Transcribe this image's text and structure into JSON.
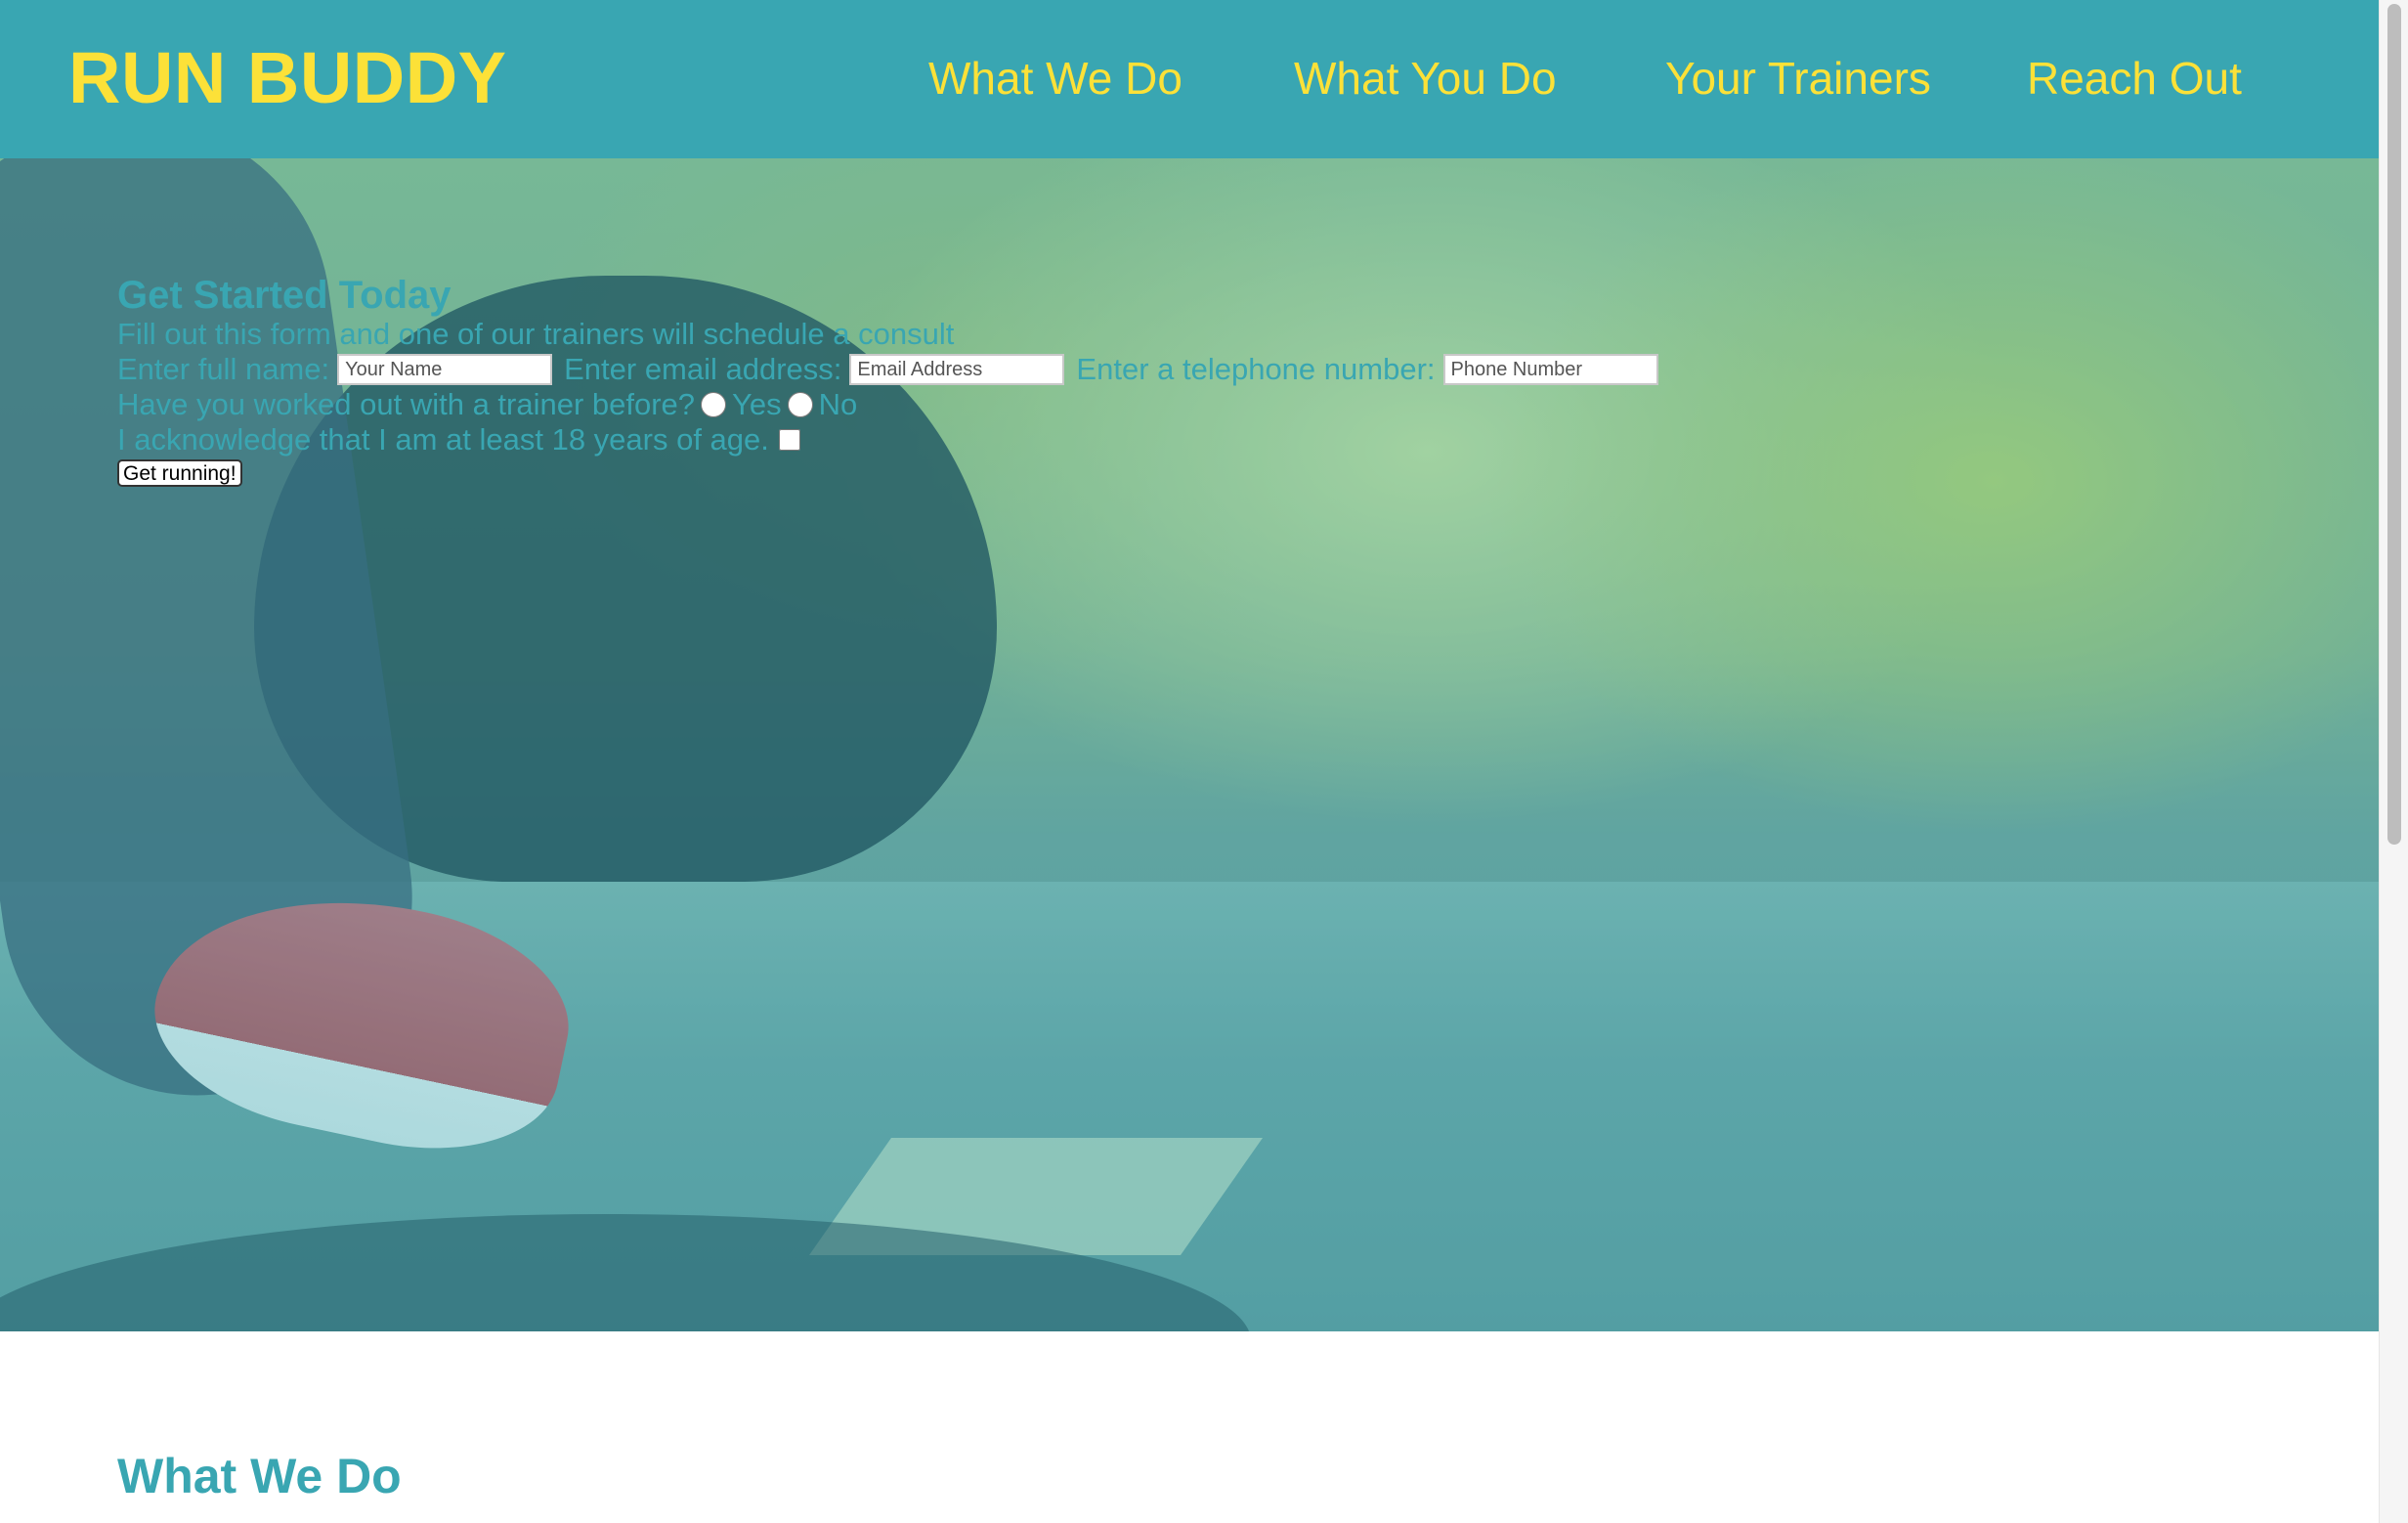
{
  "header": {
    "brand": "RUN BUDDY",
    "nav": [
      {
        "label": "What We Do"
      },
      {
        "label": "What You Do"
      },
      {
        "label": "Your Trainers"
      },
      {
        "label": "Reach Out"
      }
    ]
  },
  "hero": {
    "form": {
      "title": "Get Started Today",
      "subtitle": "Fill out this form and one of our trainers will schedule a consult",
      "name_label": "Enter full name:",
      "name_placeholder": "Your Name",
      "email_label": "Enter email address:",
      "email_placeholder": "Email Address",
      "phone_label": "Enter a telephone number:",
      "phone_placeholder": "Phone Number",
      "trainer_question": "Have you worked out with a trainer before?",
      "yes_label": "Yes",
      "no_label": "No",
      "age_ack": "I acknowledge that I am at least 18 years of age.",
      "submit_label": "Get running!"
    }
  },
  "section": {
    "title": "What We Do"
  },
  "colors": {
    "primary": "#39a6b2",
    "accent": "#fce138"
  }
}
